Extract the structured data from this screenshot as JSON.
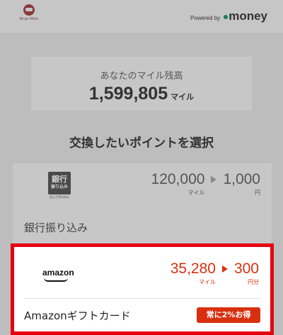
{
  "header": {
    "logo_text": "Ninja Miles",
    "powered_by": "Powered by",
    "money_brand": "money"
  },
  "balance": {
    "label": "あなたのマイル残高",
    "value": "1,599,805",
    "unit": "マイル"
  },
  "section": {
    "title": "交換したいポイントを選択"
  },
  "options": [
    {
      "name": "銀行振り込み",
      "icon": "bank-transfer-icon",
      "icon_text_line1": "銀行",
      "icon_text_line2": "振り込み",
      "icon_caption": "振込手数料無料",
      "from_value": "120,000",
      "from_unit": "マイル",
      "to_value": "1,000",
      "to_unit": "円",
      "highlighted": false
    },
    {
      "name": "Amazonギフトカード",
      "icon": "amazon-logo-icon",
      "logo_text": "amazon",
      "from_value": "35,280",
      "from_unit": "マイル",
      "to_value": "300",
      "to_unit": "円分",
      "badge": "常に2%お得",
      "highlighted": true
    }
  ],
  "colors": {
    "accent": "#d8300f",
    "highlight_border": "#e60012",
    "money_dot": "#1b7f5a",
    "overlay": "#bdbdbd"
  }
}
